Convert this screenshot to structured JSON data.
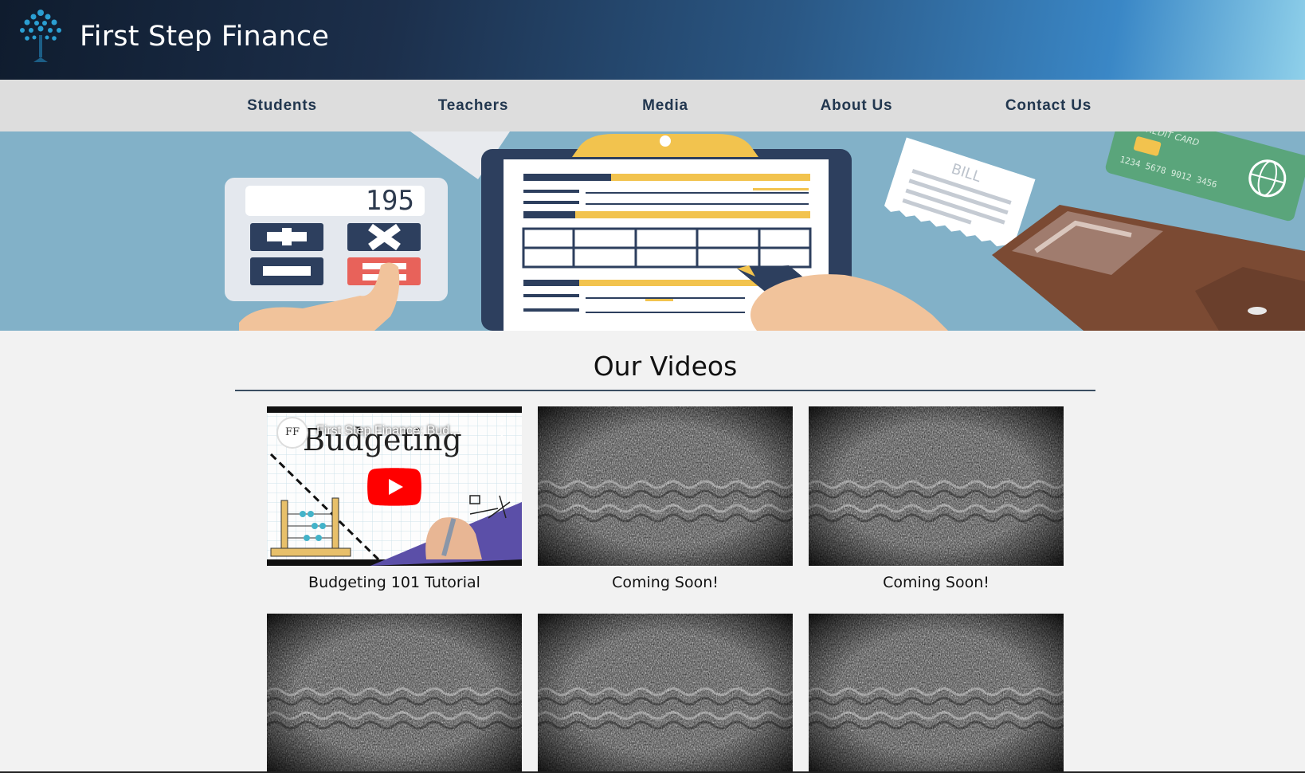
{
  "header": {
    "brand": "First Step Finance",
    "logo_icon": "tree-logo-icon"
  },
  "nav": {
    "items": [
      {
        "label": "Students"
      },
      {
        "label": "Teachers"
      },
      {
        "label": "Media"
      },
      {
        "label": "About Us"
      },
      {
        "label": "Contact Us"
      }
    ]
  },
  "banner": {
    "calculator_display": "195",
    "bill_label": "BILL",
    "card_label": "CREDIT CARD",
    "card_number": "1234 5678 9012 3456"
  },
  "main": {
    "section_title": "Our Videos",
    "videos": [
      {
        "caption": "Budgeting 101 Tutorial",
        "player_title": "First Step Finance: Bud...",
        "thumbnail_text": "Budgeting",
        "channel_avatar": "FF",
        "menu_glyph": "⋮",
        "status": "embedded-video"
      },
      {
        "caption": "Coming Soon!",
        "status": "static-placeholder"
      },
      {
        "caption": "Coming Soon!",
        "status": "static-placeholder"
      },
      {
        "caption": "",
        "status": "static-placeholder"
      },
      {
        "caption": "",
        "status": "static-placeholder"
      },
      {
        "caption": "",
        "status": "static-placeholder"
      }
    ]
  },
  "colors": {
    "header_dark": "#0f1c2e",
    "header_light": "#8fd0ea",
    "nav_bg": "#dddddd",
    "nav_text": "#22374f",
    "banner_bg": "#82b1c8",
    "youtube_red": "#ff0000"
  }
}
